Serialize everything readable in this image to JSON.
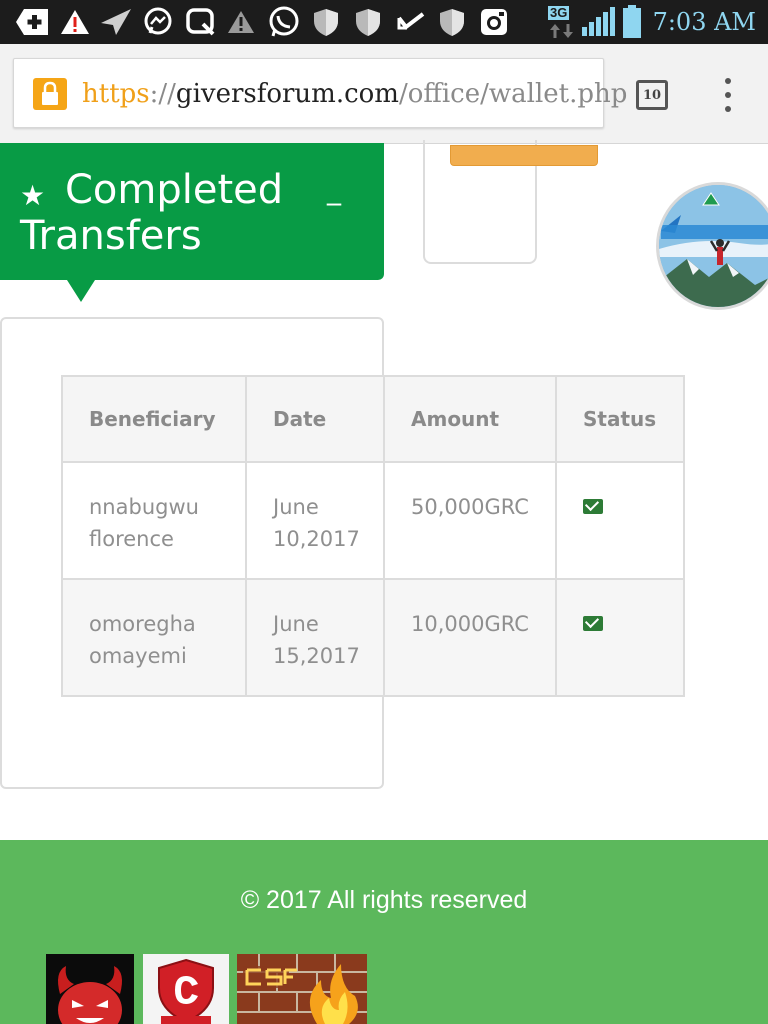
{
  "status_bar": {
    "time": "7:03 AM",
    "network": "3G",
    "icons": [
      "add-icon",
      "warning-icon",
      "send-icon",
      "messenger-icon",
      "search-icon",
      "alert-icon",
      "whatsapp-icon",
      "shield-icon",
      "shield-icon",
      "check-icon",
      "shield-icon",
      "instagram-icon",
      "signal-icon",
      "battery-icon"
    ]
  },
  "browser": {
    "url_scheme": "https",
    "url_sep": "://",
    "url_host": "giversforum.com",
    "url_path": "/office/wallet.php",
    "tab_count": "10",
    "lock_icon": "lock-icon",
    "menu_icon": "more-vert-icon"
  },
  "panel": {
    "title": "Completed Transfers",
    "star_icon": "★",
    "collapse_label": "_",
    "accent_color": "#089b45"
  },
  "table": {
    "headers": [
      "Beneficiary",
      "Date",
      "Amount",
      "Status"
    ],
    "rows": [
      {
        "beneficiary": "nnabugwu florence",
        "date": "June 10,2017",
        "amount": "50,000GRC",
        "status_icon": "envelope-icon"
      },
      {
        "beneficiary": "omoregha omayemi",
        "date": "June 15,2017",
        "amount": "10,000GRC",
        "status_icon": "envelope-icon"
      }
    ]
  },
  "footer": {
    "copyright": "© 2017 All rights reserved",
    "background": "#5cb85c",
    "badges": [
      "ddos-devil-badge",
      "comodo-badge",
      "csf-firewall-badge"
    ]
  }
}
